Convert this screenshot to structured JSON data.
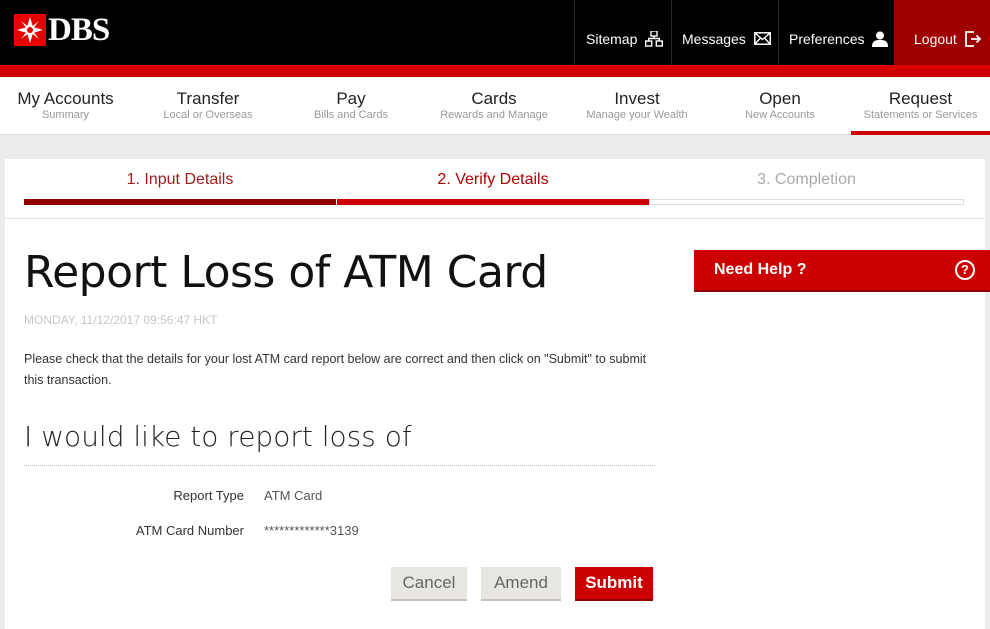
{
  "brand": {
    "name": "DBS"
  },
  "top_links": [
    {
      "label": "Sitemap",
      "icon": "sitemap-icon"
    },
    {
      "label": "Messages",
      "icon": "envelope-icon"
    },
    {
      "label": "Preferences",
      "icon": "user-icon"
    },
    {
      "label": "Logout",
      "icon": "logout-icon"
    }
  ],
  "nav": [
    {
      "title": "My Accounts",
      "subtitle": "Summary"
    },
    {
      "title": "Transfer",
      "subtitle": "Local or Overseas"
    },
    {
      "title": "Pay",
      "subtitle": "Bills and Cards"
    },
    {
      "title": "Cards",
      "subtitle": "Rewards and Manage"
    },
    {
      "title": "Invest",
      "subtitle": "Manage your Wealth"
    },
    {
      "title": "Open",
      "subtitle": "New Accounts"
    },
    {
      "title": "Request",
      "subtitle": "Statements or Services",
      "active": true
    }
  ],
  "steps": [
    {
      "label": "1. Input Details",
      "state": "done"
    },
    {
      "label": "2. Verify Details",
      "state": "current"
    },
    {
      "label": "3. Completion",
      "state": "pending"
    }
  ],
  "page": {
    "title": "Report Loss of ATM Card",
    "timestamp": "MONDAY, 11/12/2017 09:56:47 HKT",
    "description": "Please check that the details for your lost ATM card report below are correct and then click on \"Submit\" to submit this transaction.",
    "section_heading": "I would like to report loss of"
  },
  "fields": [
    {
      "label": "Report Type",
      "value": "ATM Card"
    },
    {
      "label": "ATM Card Number",
      "value": "*************3139"
    }
  ],
  "buttons": {
    "cancel": "Cancel",
    "amend": "Amend",
    "submit": "Submit"
  },
  "help": {
    "label": "Need Help ?",
    "icon_text": "?"
  },
  "colors": {
    "brand_red": "#cc0000",
    "dark_red": "#8e0000",
    "black": "#000000"
  }
}
